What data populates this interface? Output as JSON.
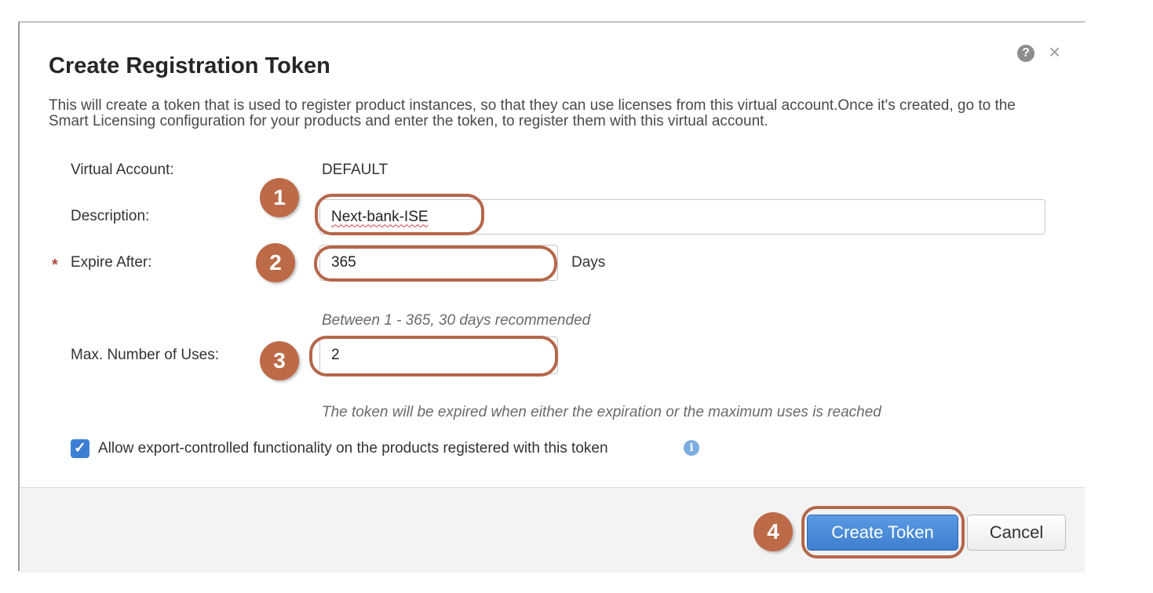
{
  "dialog": {
    "title": "Create Registration Token",
    "description": "This will create a token that is used to register product instances, so that they can use licenses from this virtual account.Once it's created, go to the Smart Licensing configuration for your products and enter the token, to register them with this virtual account.",
    "help_icon": "?",
    "close_icon": "×"
  },
  "form": {
    "virtual_account_label": "Virtual Account:",
    "virtual_account_value": "DEFAULT",
    "description_label": "Description:",
    "description_value": "Next-bank-ISE",
    "required_marker": "*",
    "expire_label": "Expire After:",
    "expire_value": "365",
    "expire_unit": "Days",
    "expire_hint": "Between 1 - 365, 30 days recommended",
    "max_uses_label": "Max. Number of Uses:",
    "max_uses_value": "2",
    "max_uses_hint": "The token will be expired when either the expiration or the maximum uses is reached",
    "export_checkbox_mark": "✓",
    "export_label": "Allow export-controlled functionality on the products registered with this token",
    "export_checked": true,
    "info_icon": "i"
  },
  "annotations": [
    "1",
    "2",
    "3",
    "4"
  ],
  "footer": {
    "create_label": "Create Token",
    "cancel_label": "Cancel"
  },
  "colors": {
    "annotation": "#bd6a48",
    "primary_button": "#4a8ad9",
    "checkbox": "#3b7fd4",
    "required": "#b1493a"
  }
}
